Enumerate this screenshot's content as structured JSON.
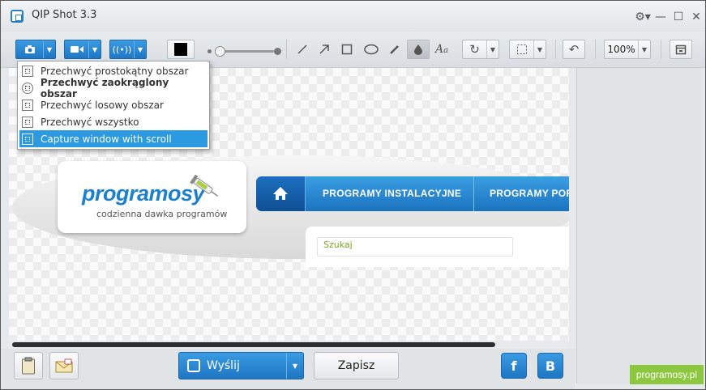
{
  "window": {
    "title": "QIP Shot 3.3"
  },
  "toolbar": {
    "zoom": "100%",
    "color": "#000000"
  },
  "capture_menu": {
    "items": [
      {
        "label": "Przechwyć prostokątny obszar",
        "bold": false,
        "selected": false
      },
      {
        "label": "Przechwyć zaokrąglony obszar",
        "bold": true,
        "selected": false
      },
      {
        "label": "Przechwyć losowy obszar",
        "bold": false,
        "selected": false
      },
      {
        "label": "Przechwyć wszystko",
        "bold": false,
        "selected": false
      },
      {
        "label": "Capture window with scroll",
        "bold": false,
        "selected": true
      }
    ]
  },
  "site": {
    "logo": "programosy",
    "tagline": "codzienna dawka programów",
    "nav": [
      "PROGRAMY INSTALACYJNE",
      "PROGRAMY POR"
    ],
    "search_placeholder": "Szukaj"
  },
  "bottom": {
    "send_label": "Wyślij",
    "save_label": "Zapisz",
    "facebook": "f",
    "vk": "B"
  },
  "watermark": "programosy.pl",
  "colors": {
    "accent": "#2b9ae0",
    "site_blue": "#1e80c8",
    "watermark_green": "#8dc63f"
  }
}
